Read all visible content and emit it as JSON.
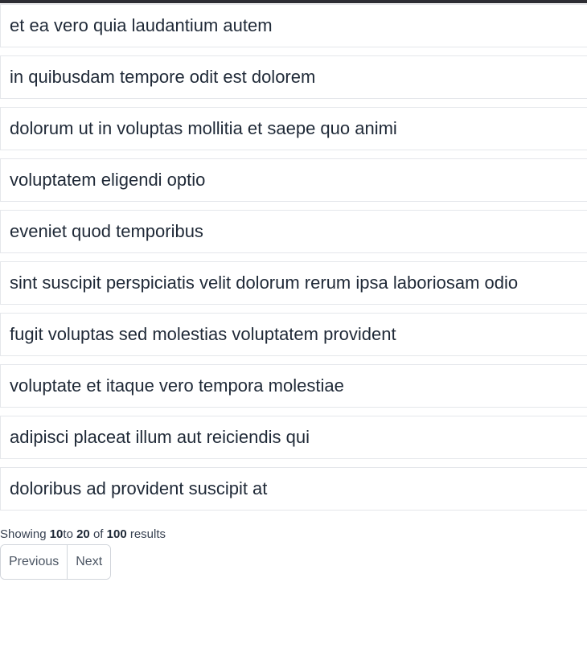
{
  "items": [
    "et ea vero quia laudantium autem",
    "in quibusdam tempore odit est dolorem",
    "dolorum ut in voluptas mollitia et saepe quo animi",
    "voluptatem eligendi optio",
    "eveniet quod temporibus",
    "sint suscipit perspiciatis velit dolorum rerum ipsa laboriosam odio",
    "fugit voluptas sed molestias voluptatem provident",
    "voluptate et itaque vero tempora molestiae",
    "adipisci placeat illum aut reiciendis qui",
    "doloribus ad provident suscipit at"
  ],
  "summary": {
    "prefix": "Showing ",
    "from": "10",
    "to_word": "to ",
    "to": "20",
    "of_word": " of ",
    "total": "100",
    "suffix": " results"
  },
  "pagination": {
    "previous_label": "Previous",
    "next_label": "Next"
  }
}
